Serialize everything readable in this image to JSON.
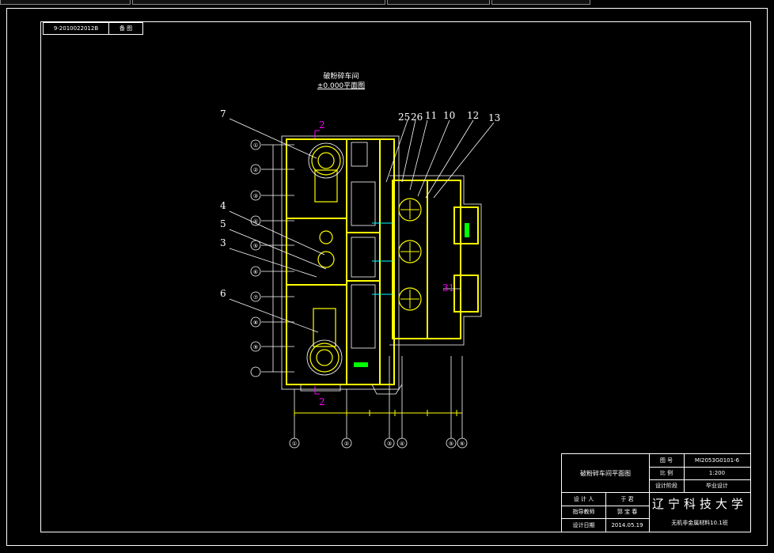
{
  "ref_box": {
    "number": "9-2010022012B",
    "label": "备  图"
  },
  "drawing_title": {
    "name": "破粉碎车间",
    "subtitle": "±0.000平面图"
  },
  "callouts": {
    "c7": "7",
    "c4": "4",
    "c5": "5",
    "c3": "3",
    "c6": "6",
    "c25": "25",
    "c26": "26",
    "c11": "11",
    "c10": "10",
    "c12": "12",
    "c13": "13",
    "c31": "31",
    "sec_top": "2",
    "sec_bottom": "2"
  },
  "axis_left": [
    "①",
    "②",
    "③",
    "④",
    "⑤",
    "⑥",
    "⑦",
    "⑧",
    "⑨"
  ],
  "axis_bottom": [
    "①",
    "②",
    "③",
    "④",
    "⑤",
    "⑥"
  ],
  "title_block": {
    "drawing_name": "破粉碎车间平面图",
    "drawing_no_label": "图  号",
    "drawing_no": "MI2053G0101-6",
    "scale_label": "比  例",
    "scale": "1:200",
    "stage_label": "设计阶段",
    "stage": "毕业设计",
    "designer_label": "设 计 人",
    "designer": "于 君",
    "advisor_label": "指导教师",
    "advisor": "郭 宝 春",
    "date_label": "设计日期",
    "date": "2014.05.19",
    "university": "辽宁科技大学",
    "class": "无机非金属材料10.1班"
  },
  "colors": {
    "wall": "#ffff00",
    "cyan": "#00ffff",
    "magenta": "#ff00ff",
    "green": "#00ff00",
    "line": "#ffffff"
  }
}
